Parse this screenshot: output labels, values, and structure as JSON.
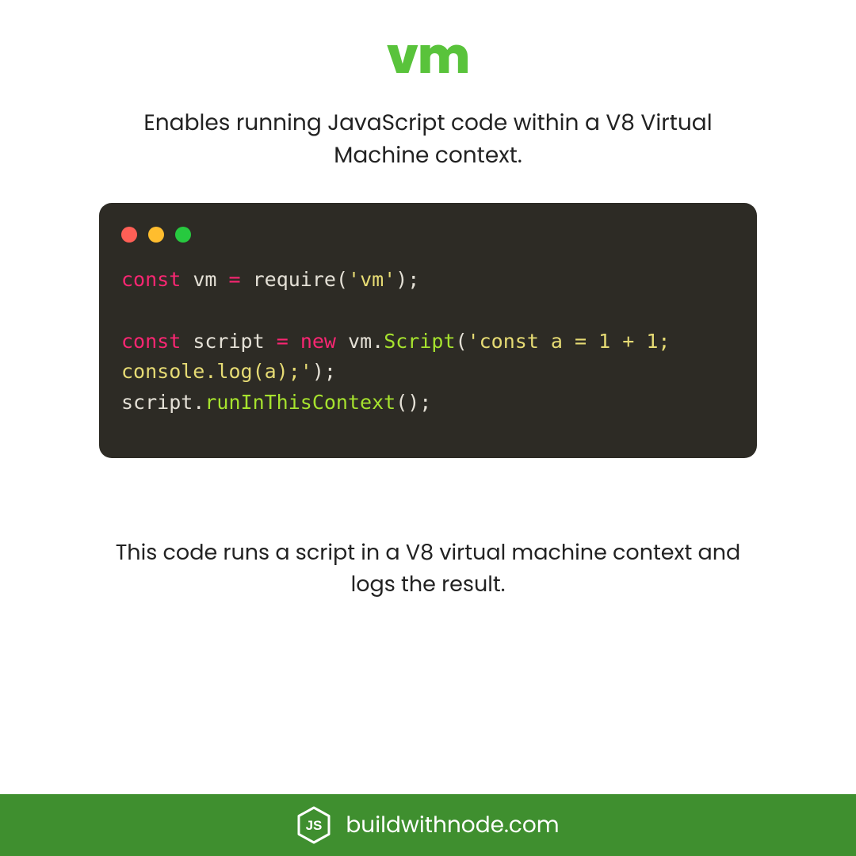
{
  "header": {
    "title": "vm",
    "subtitle": "Enables running JavaScript code within a V8 Virtual Machine context."
  },
  "code": {
    "window_dots": [
      "red",
      "yellow",
      "green"
    ],
    "lines": [
      [
        {
          "cls": "tok-kw",
          "text": "const"
        },
        {
          "cls": "tok-plain",
          "text": " vm "
        },
        {
          "cls": "tok-kw",
          "text": "="
        },
        {
          "cls": "tok-plain",
          "text": " require("
        },
        {
          "cls": "tok-str",
          "text": "'vm'"
        },
        {
          "cls": "tok-plain",
          "text": ");"
        }
      ],
      [
        {
          "cls": "tok-plain",
          "text": ""
        }
      ],
      [
        {
          "cls": "tok-kw",
          "text": "const"
        },
        {
          "cls": "tok-plain",
          "text": " script "
        },
        {
          "cls": "tok-kw",
          "text": "="
        },
        {
          "cls": "tok-plain",
          "text": " "
        },
        {
          "cls": "tok-kw",
          "text": "new"
        },
        {
          "cls": "tok-plain",
          "text": " vm."
        },
        {
          "cls": "tok-fn",
          "text": "Script"
        },
        {
          "cls": "tok-plain",
          "text": "("
        },
        {
          "cls": "tok-str",
          "text": "'const a = 1 + 1; console.log(a);'"
        },
        {
          "cls": "tok-plain",
          "text": ");"
        }
      ],
      [
        {
          "cls": "tok-plain",
          "text": "script."
        },
        {
          "cls": "tok-fn",
          "text": "runInThisContext"
        },
        {
          "cls": "tok-plain",
          "text": "();"
        }
      ]
    ]
  },
  "caption": "This code runs a script in a V8 virtual machine context and logs the result.",
  "footer": {
    "site": "buildwithnode.com",
    "logo_label": "JS"
  },
  "colors": {
    "accent_green": "#59c33b",
    "footer_green": "#3f8f2f",
    "code_bg": "#2d2b25"
  }
}
